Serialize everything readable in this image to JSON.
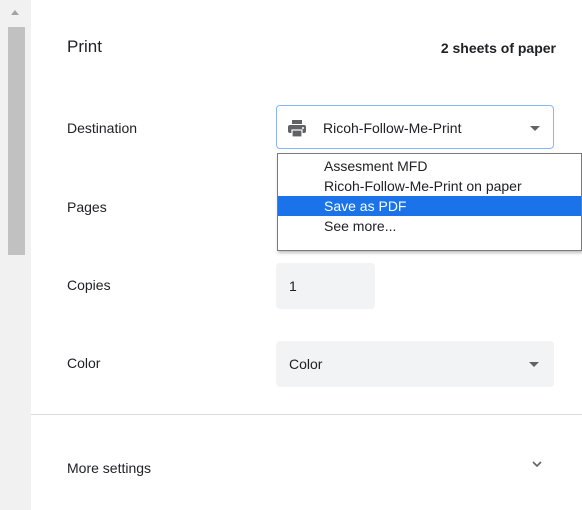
{
  "header": {
    "title": "Print",
    "sheets": "2 sheets of paper"
  },
  "destination": {
    "label": "Destination",
    "selected": "Ricoh-Follow-Me-Print",
    "options": [
      {
        "label": "Assesment MFD",
        "selected": false
      },
      {
        "label": "Ricoh-Follow-Me-Print on paper",
        "selected": false
      },
      {
        "label": "Save as PDF",
        "selected": true
      },
      {
        "label": "See more...",
        "selected": false
      }
    ]
  },
  "pages": {
    "label": "Pages"
  },
  "copies": {
    "label": "Copies",
    "value": "1"
  },
  "color": {
    "label": "Color",
    "value": "Color"
  },
  "more_settings": {
    "label": "More settings"
  },
  "icons": {
    "printer": "printer-icon",
    "dropdown": "caret-down-icon",
    "expand": "chevron-down-icon"
  },
  "colors": {
    "accent": "#1a73e8",
    "focus_border": "#8ab4f8",
    "field_bg": "#f1f3f4"
  }
}
